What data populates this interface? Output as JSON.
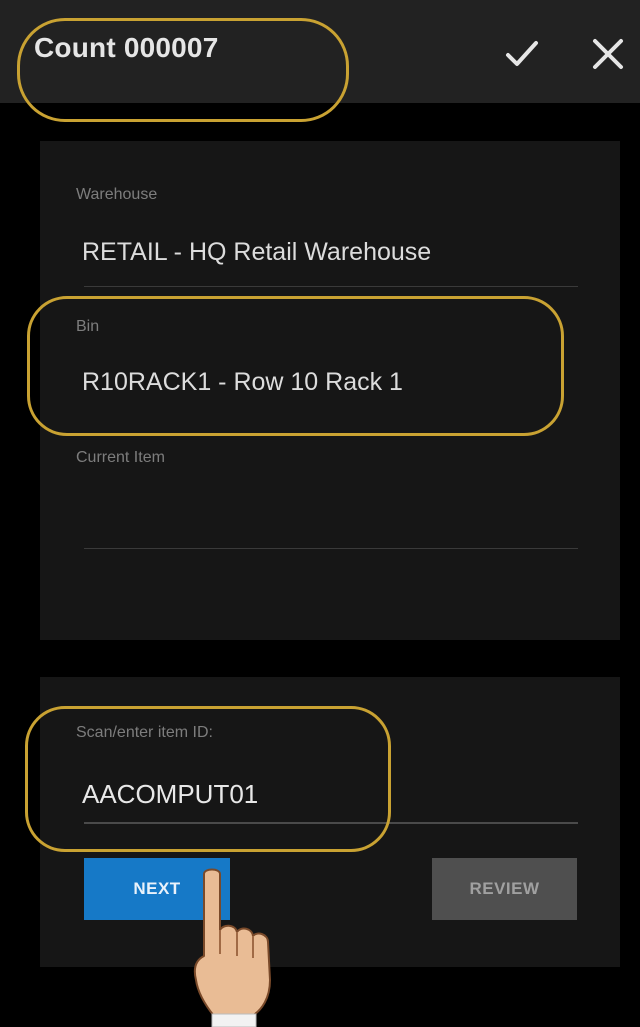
{
  "header": {
    "title": "Count 000007",
    "confirm_icon": "check-icon",
    "close_icon": "close-icon"
  },
  "panel": {
    "warehouse": {
      "label": "Warehouse",
      "value": "RETAIL - HQ Retail Warehouse"
    },
    "bin": {
      "label": "Bin",
      "value": "R10RACK1 - Row 10 Rack 1"
    },
    "current_item": {
      "label": "Current Item",
      "value": ""
    }
  },
  "scan": {
    "label": "Scan/enter item ID:",
    "value": "AACOMPUT01",
    "next_label": "NEXT",
    "review_label": "REVIEW"
  },
  "colors": {
    "header_bg": "#222222",
    "panel_bg": "#161616",
    "highlight_ring": "#c9a232",
    "next_button": "#1679c7",
    "review_button": "#4f4f4f"
  }
}
